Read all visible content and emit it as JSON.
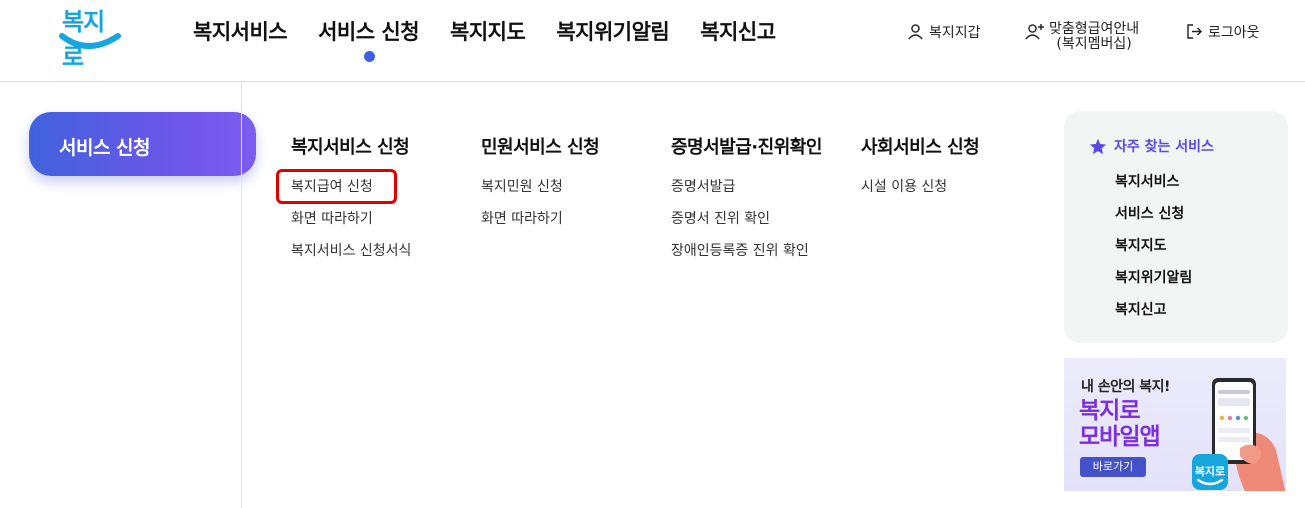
{
  "header": {
    "logo_text": "복지로",
    "nav": [
      {
        "label": "복지서비스",
        "active": false
      },
      {
        "label": "서비스 신청",
        "active": true
      },
      {
        "label": "복지지도",
        "active": false
      },
      {
        "label": "복지위기알림",
        "active": false
      },
      {
        "label": "복지신고",
        "active": false
      }
    ],
    "util": {
      "wallet": "복지지갑",
      "membership_line1": "맞춤형급여안내",
      "membership_line2": "(복지멤버십)",
      "logout": "로그아웃"
    }
  },
  "sidebar": {
    "title": "서비스 신청"
  },
  "menu": {
    "columns": [
      {
        "title": "복지서비스 신청",
        "links": [
          "복지급여 신청",
          "화면 따라하기",
          "복지서비스 신청서식"
        ]
      },
      {
        "title": "민원서비스 신청",
        "links": [
          "복지민원 신청",
          "화면 따라하기"
        ]
      },
      {
        "title": "증명서발급·진위확인",
        "links": [
          "증명서발급",
          "증명서 진위 확인",
          "장애인등록증 진위 확인"
        ]
      },
      {
        "title": "사회서비스 신청",
        "links": [
          "시설 이용 신청"
        ]
      }
    ]
  },
  "favorites": {
    "title": "자주 찾는 서비스",
    "items": [
      "복지서비스",
      "서비스 신청",
      "복지지도",
      "복지위기알림",
      "복지신고"
    ]
  },
  "banner": {
    "subtitle": "내 손안의 복지!",
    "title_line1": "복지로",
    "title_line2": "모바일앱",
    "button": "바로가기",
    "app_icon_text": "복지로"
  },
  "colors": {
    "accent_blue": "#3f5fe0",
    "pill_start": "#4062dd",
    "pill_end": "#7c5bf0",
    "favorites_title": "#5b48e6",
    "banner_title": "#7b2fe0",
    "highlight_border": "#e00000",
    "logo": "#17a5de"
  }
}
